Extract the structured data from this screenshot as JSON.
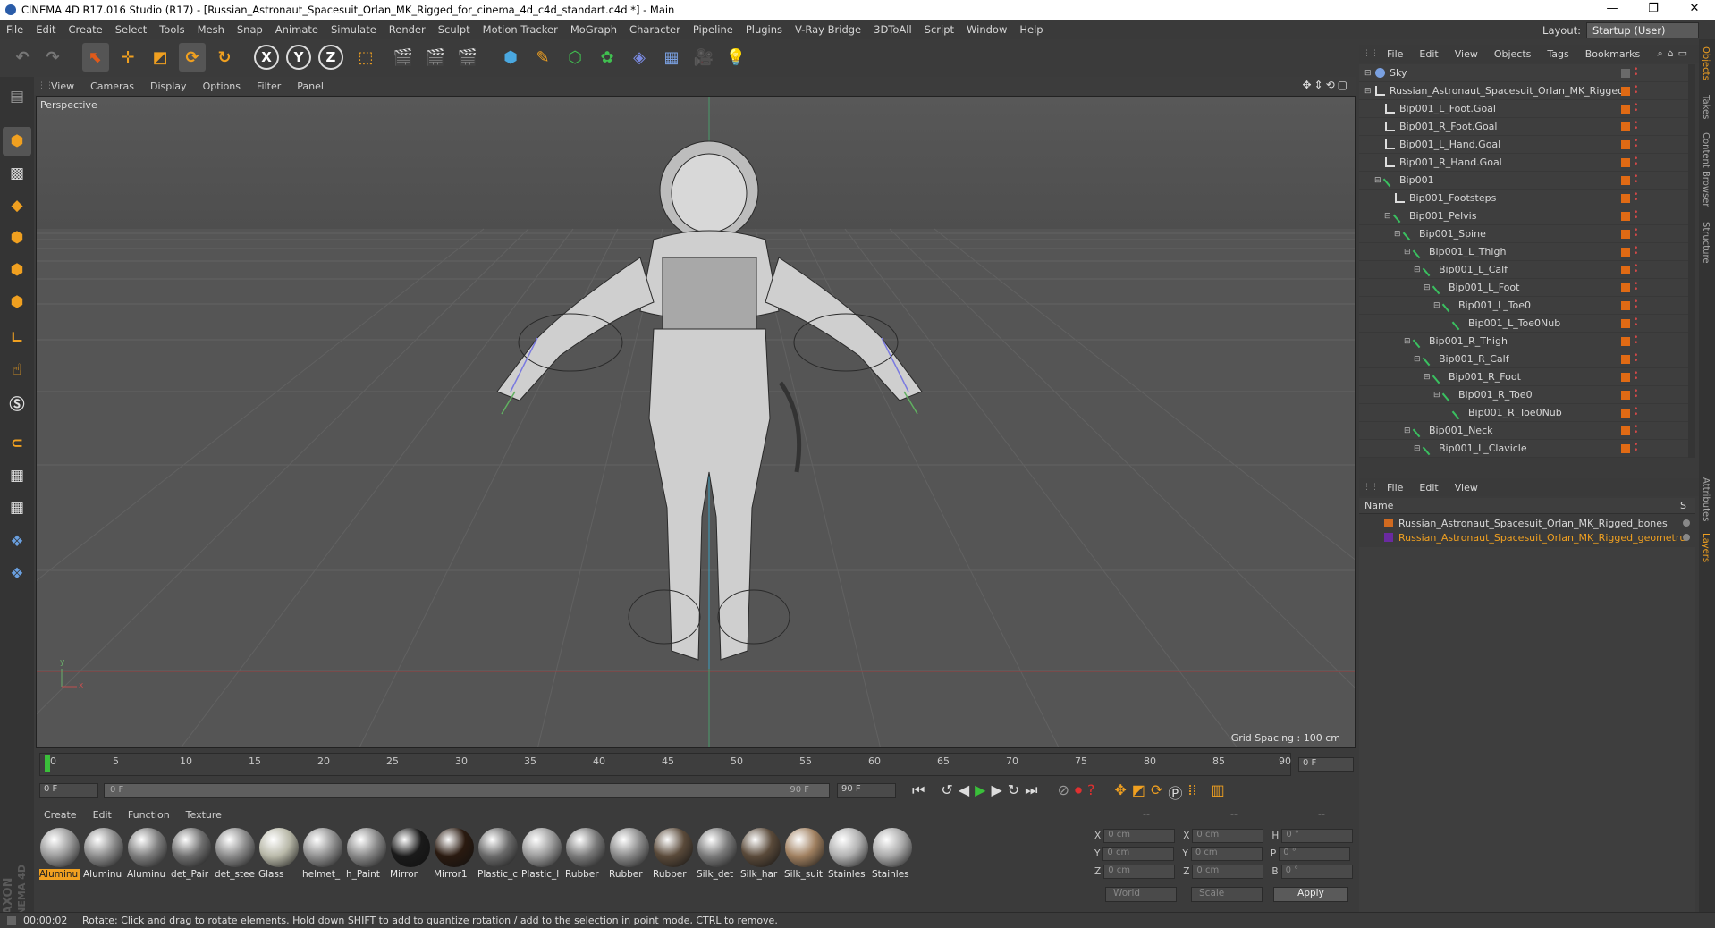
{
  "window": {
    "title": "CINEMA 4D R17.016 Studio (R17) - [Russian_Astronaut_Spacesuit_Orlan_MK_Rigged_for_cinema_4d_c4d_standart.c4d *] - Main",
    "minimize": "—",
    "restore": "❐",
    "close": "✕"
  },
  "menubar": {
    "items": [
      "File",
      "Edit",
      "Create",
      "Select",
      "Tools",
      "Mesh",
      "Snap",
      "Animate",
      "Simulate",
      "Render",
      "Sculpt",
      "Motion Tracker",
      "MoGraph",
      "Character",
      "Pipeline",
      "Plugins",
      "V-Ray Bridge",
      "3DToAll",
      "Script",
      "Window",
      "Help"
    ],
    "layout_label": "Layout:",
    "layout_value": "Startup (User)"
  },
  "toolbar": {
    "axis_x": "X",
    "axis_y": "Y",
    "axis_z": "Z"
  },
  "viewport": {
    "menu": [
      "View",
      "Cameras",
      "Display",
      "Options",
      "Filter",
      "Panel"
    ],
    "label": "Perspective",
    "grid_spacing": "Grid Spacing : 100 cm",
    "axis_y": "y",
    "axis_x": "x"
  },
  "timeline": {
    "ticks": [
      "0",
      "5",
      "10",
      "15",
      "20",
      "25",
      "30",
      "35",
      "40",
      "45",
      "50",
      "55",
      "60",
      "65",
      "70",
      "75",
      "80",
      "85",
      "90"
    ],
    "current_frame": "0 F",
    "start": "0 F",
    "range_start": "0 F",
    "range_end": "90 F",
    "end": "90 F"
  },
  "materials": {
    "menu": [
      "Create",
      "Edit",
      "Function",
      "Texture"
    ],
    "items": [
      {
        "name": "Aluminu",
        "color": "#9a9a9a",
        "selected": true
      },
      {
        "name": "Aluminu",
        "color": "#8c8c8c"
      },
      {
        "name": "Aluminu",
        "color": "#7e7e7e"
      },
      {
        "name": "det_Pair",
        "color": "#6f6f6f"
      },
      {
        "name": "det_stee",
        "color": "#8a8a8a"
      },
      {
        "name": "Glass",
        "color": "#b8b8a8"
      },
      {
        "name": "helmet_",
        "color": "#909090"
      },
      {
        "name": "h_Paint",
        "color": "#888888"
      },
      {
        "name": "Mirror",
        "color": "#1a1a1a"
      },
      {
        "name": "Mirror1",
        "color": "#2a1a10"
      },
      {
        "name": "Plastic_c",
        "color": "#6a6a6a"
      },
      {
        "name": "Plastic_l",
        "color": "#9a9a9a"
      },
      {
        "name": "Rubber",
        "color": "#7a7a7a"
      },
      {
        "name": "Rubber",
        "color": "#8a8a8a"
      },
      {
        "name": "Rubber",
        "color": "#5a4a3a"
      },
      {
        "name": "Silk_det",
        "color": "#7a7a7a"
      },
      {
        "name": "Silk_har",
        "color": "#5a4a3a"
      },
      {
        "name": "Silk_suit",
        "color": "#a08060"
      },
      {
        "name": "Stainles",
        "color": "#b0b0b0"
      },
      {
        "name": "Stainles",
        "color": "#a8a8a8"
      }
    ]
  },
  "coords": {
    "header": [
      "--",
      "--",
      "--"
    ],
    "rows": [
      {
        "a": "X",
        "av": "0 cm",
        "b": "X",
        "bv": "0 cm",
        "c": "H",
        "cv": "0 °"
      },
      {
        "a": "Y",
        "av": "0 cm",
        "b": "Y",
        "bv": "0 cm",
        "c": "P",
        "cv": "0 °"
      },
      {
        "a": "Z",
        "av": "0 cm",
        "b": "Z",
        "bv": "0 cm",
        "c": "B",
        "cv": "0 °"
      }
    ],
    "world": "World",
    "scale": "Scale",
    "apply": "Apply"
  },
  "objects": {
    "menu": [
      "File",
      "Edit",
      "View",
      "Objects",
      "Tags",
      "Bookmarks"
    ],
    "rows": [
      {
        "label": "Sky",
        "indent": 0,
        "kind": "sky"
      },
      {
        "label": "Russian_Astronaut_Spacesuit_Orlan_MK_Rigged",
        "indent": 0,
        "kind": "null"
      },
      {
        "label": "Bip001_L_Foot.Goal",
        "indent": 1,
        "kind": "null"
      },
      {
        "label": "Bip001_R_Foot.Goal",
        "indent": 1,
        "kind": "null"
      },
      {
        "label": "Bip001_L_Hand.Goal",
        "indent": 1,
        "kind": "null"
      },
      {
        "label": "Bip001_R_Hand.Goal",
        "indent": 1,
        "kind": "null"
      },
      {
        "label": "Bip001",
        "indent": 1,
        "kind": "bone"
      },
      {
        "label": "Bip001_Footsteps",
        "indent": 2,
        "kind": "null"
      },
      {
        "label": "Bip001_Pelvis",
        "indent": 2,
        "kind": "bone"
      },
      {
        "label": "Bip001_Spine",
        "indent": 3,
        "kind": "bone"
      },
      {
        "label": "Bip001_L_Thigh",
        "indent": 4,
        "kind": "bone"
      },
      {
        "label": "Bip001_L_Calf",
        "indent": 5,
        "kind": "bone"
      },
      {
        "label": "Bip001_L_Foot",
        "indent": 6,
        "kind": "bone"
      },
      {
        "label": "Bip001_L_Toe0",
        "indent": 7,
        "kind": "bone"
      },
      {
        "label": "Bip001_L_Toe0Nub",
        "indent": 8,
        "kind": "bone"
      },
      {
        "label": "Bip001_R_Thigh",
        "indent": 4,
        "kind": "bone"
      },
      {
        "label": "Bip001_R_Calf",
        "indent": 5,
        "kind": "bone"
      },
      {
        "label": "Bip001_R_Foot",
        "indent": 6,
        "kind": "bone"
      },
      {
        "label": "Bip001_R_Toe0",
        "indent": 7,
        "kind": "bone"
      },
      {
        "label": "Bip001_R_Toe0Nub",
        "indent": 8,
        "kind": "bone"
      },
      {
        "label": "Bip001_Neck",
        "indent": 4,
        "kind": "bone"
      },
      {
        "label": "Bip001_L_Clavicle",
        "indent": 5,
        "kind": "bone"
      }
    ]
  },
  "layers": {
    "menu": [
      "File",
      "Edit",
      "View"
    ],
    "header": "Name",
    "header_s": "S",
    "items": [
      {
        "name": "Russian_Astronaut_Spacesuit_Orlan_MK_Rigged_bones",
        "color": "#d06a20",
        "text": "#d8d8d8"
      },
      {
        "name": "Russian_Astronaut_Spacesuit_Orlan_MK_Rigged_geometru",
        "color": "#6a2aa0",
        "text": "#f0a020"
      }
    ]
  },
  "side_tabs": [
    "Objects",
    "Takes",
    "Content Browser",
    "Structure",
    "Attributes",
    "Layers"
  ],
  "brand": {
    "line1": "MAXON",
    "line2": "CINEMA 4D"
  },
  "status": {
    "time": "00:00:02",
    "message": "Rotate: Click and drag to rotate elements. Hold down SHIFT to add to quantize rotation / add to the selection in point mode, CTRL to remove."
  }
}
